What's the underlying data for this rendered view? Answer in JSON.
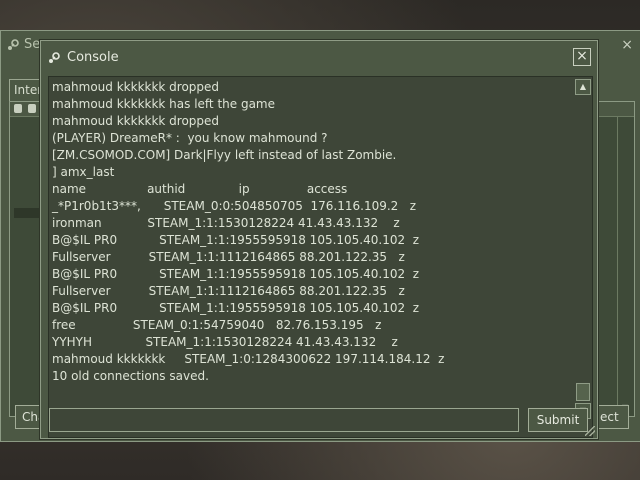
{
  "background_window": {
    "title_fragment": "Se",
    "close_glyph": "×",
    "tab_fragment": "Inter",
    "left_button_fragment": "Cha",
    "right_button_fragment": "ect"
  },
  "console": {
    "title": "Console",
    "close_glyph": "×",
    "lines": [
      "mahmoud kkkkkkk dropped",
      "mahmoud kkkkkkk has left the game",
      "mahmoud kkkkkkk dropped",
      "(PLAYER) DreameR* :  you know mahmound ?",
      "[ZM.CSOMOD.COM] Dark|Flyy left instead of last Zombie.",
      "] amx_last",
      "name                authid              ip               access",
      "_*P1r0b1t3***,      STEAM_0:0:504850705  176.116.109.2   z",
      "ironman            STEAM_1:1:1530128224 41.43.43.132    z",
      "B@$IL PR0           STEAM_1:1:1955595918 105.105.40.102  z",
      "Fullserver          STEAM_1:1:1112164865 88.201.122.35   z",
      "B@$IL PR0           STEAM_1:1:1955595918 105.105.40.102  z",
      "Fullserver          STEAM_1:1:1112164865 88.201.122.35   z",
      "B@$IL PR0           STEAM_1:1:1955595918 105.105.40.102  z",
      "free               STEAM_0:1:54759040   82.76.153.195   z",
      "YYHYH              STEAM_1:1:1530128224 41.43.43.132    z",
      "mahmoud kkkkkkk     STEAM_1:0:1284300622 197.114.184.12  z",
      "10 old connections saved."
    ],
    "input_value": "",
    "submit_label": "Submit"
  },
  "icons": {
    "console_icon": "steam-icon",
    "scroll_up": "arrow-up-icon",
    "scroll_down": "arrow-down-icon"
  },
  "colors": {
    "window_bg": "#4c5844",
    "output_bg": "#3e4638",
    "text": "#dde3d5"
  }
}
